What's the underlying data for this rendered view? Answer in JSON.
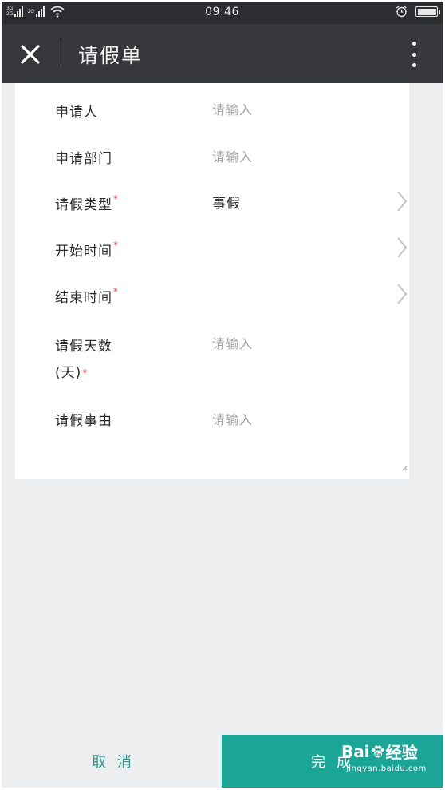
{
  "status_bar": {
    "network1": "3G",
    "network1_sub": "2G",
    "network2": "2G",
    "time": "09:46"
  },
  "app_bar": {
    "title": "请假单"
  },
  "form": {
    "rows": [
      {
        "label": "申请人",
        "placeholder": "请输入",
        "required": false
      },
      {
        "label": "申请部门",
        "placeholder": "请输入",
        "required": false
      },
      {
        "label": "请假类型",
        "value": "事假",
        "required": true
      },
      {
        "label": "开始时间",
        "value": "",
        "required": true
      },
      {
        "label": "结束时间",
        "value": "",
        "required": true
      },
      {
        "label_line1": "请假天数",
        "label_line2": "(天)",
        "placeholder": "请输入",
        "required": true
      },
      {
        "label": "请假事由",
        "placeholder": "请输入",
        "required": false
      }
    ],
    "required_mark": "*"
  },
  "actions": {
    "cancel_label": "取消",
    "done_label": "完成"
  },
  "watermark": {
    "brand": "Bai经验",
    "brand_mid": "du",
    "url": "jingyan.baidu.com"
  },
  "colors": {
    "accent": "#1aa597",
    "required": "#e23a3a",
    "app_bar": "#36383b",
    "status_bar": "#2b2d30"
  }
}
